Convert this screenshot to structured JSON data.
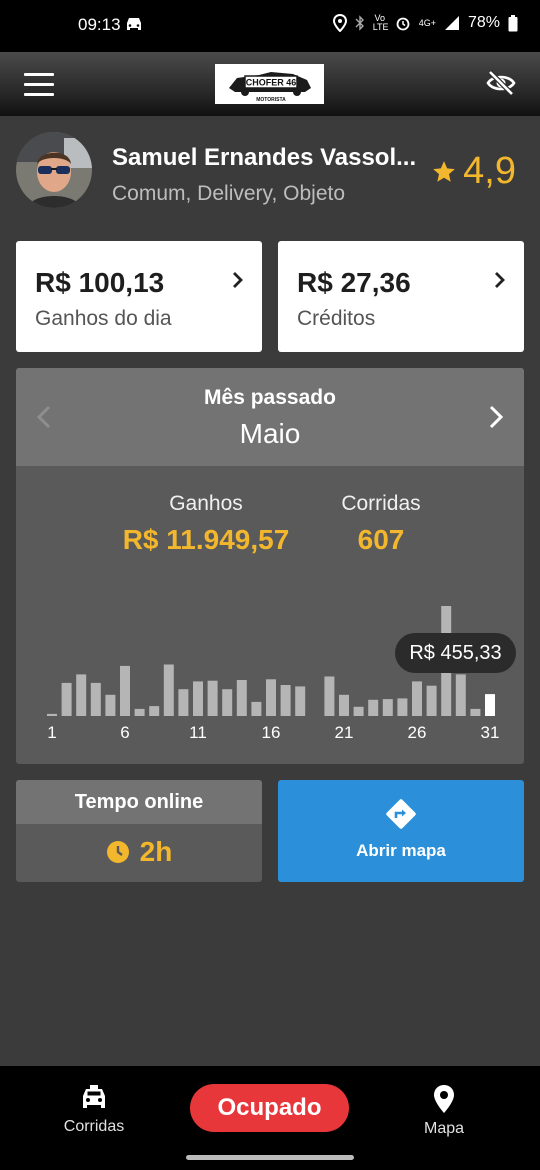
{
  "status_bar": {
    "time": "09:13",
    "volte": "Vo LTE",
    "network": "4G+",
    "battery": "78%"
  },
  "header": {
    "logo_text": "CHOFER 46",
    "logo_subtext": "MOTORISTA"
  },
  "profile": {
    "name": "Samuel Ernandes Vassol...",
    "services": "Comum, Delivery, Objeto",
    "rating": "4,9"
  },
  "cards": [
    {
      "value": "R$ 100,13",
      "label": "Ganhos do dia"
    },
    {
      "value": "R$ 27,36",
      "label": "Créditos"
    }
  ],
  "month": {
    "title": "Mês passado",
    "name": "Maio",
    "earnings_label": "Ganhos",
    "earnings_value": "R$ 11.949,57",
    "rides_label": "Corridas",
    "rides_value": "607",
    "tooltip": "R$  455,33"
  },
  "chart_data": {
    "type": "bar",
    "categories": [
      "1",
      "2",
      "3",
      "4",
      "5",
      "6",
      "7",
      "8",
      "9",
      "10",
      "11",
      "12",
      "13",
      "14",
      "15",
      "16",
      "17",
      "18",
      "19",
      "20",
      "21",
      "22",
      "23",
      "24",
      "25",
      "26",
      "27",
      "28",
      "29",
      "30",
      "31"
    ],
    "tick_labels": [
      "1",
      "6",
      "11",
      "16",
      "21",
      "26",
      "31"
    ],
    "values": [
      15,
      235,
      295,
      235,
      150,
      355,
      50,
      70,
      365,
      190,
      245,
      250,
      190,
      255,
      100,
      260,
      220,
      210,
      0,
      280,
      150,
      65,
      115,
      120,
      125,
      245,
      215,
      780,
      295,
      50,
      155
    ],
    "highlight_index": 30,
    "highlight_value": 455.33,
    "colors": {
      "bar": "#b5b5b5",
      "highlight": "#ffffff"
    }
  },
  "online": {
    "title": "Tempo online",
    "value": "2h"
  },
  "map_button": {
    "label": "Abrir mapa"
  },
  "bottom_nav": {
    "rides_label": "Corridas",
    "status_button": "Ocupado",
    "map_label": "Mapa"
  }
}
